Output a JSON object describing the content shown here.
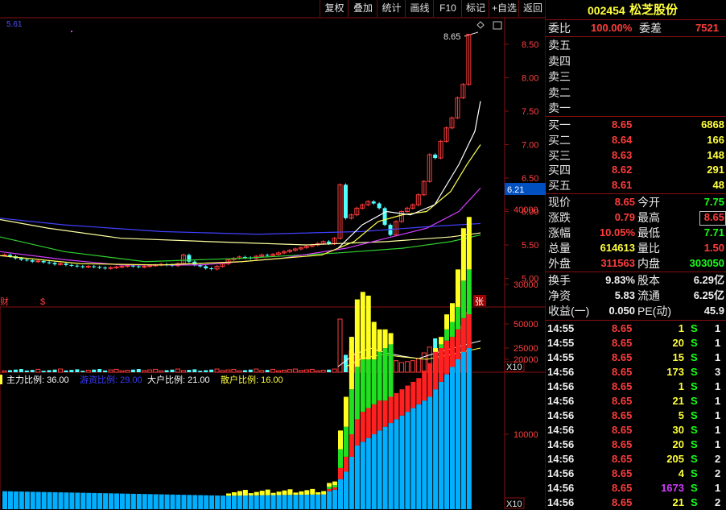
{
  "toolbar": [
    "复权",
    "叠加",
    "统计",
    "画线",
    "F10",
    "标记",
    "+自选",
    "返回"
  ],
  "stock": {
    "code": "002454",
    "name": "松芝股份"
  },
  "chart": {
    "ma_label": "5.61",
    "high_note": "8.65",
    "current_price": "6.21",
    "price_ticks": [
      "8.50",
      "8.00",
      "7.50",
      "7.00",
      "6.50",
      "6.00",
      "5.50",
      "5.00"
    ],
    "markers": {
      "cai": "财",
      "dollar": "$",
      "zhang": "张"
    },
    "vol_ticks": [
      "50000",
      "25000"
    ],
    "vol_multiplier": "X10",
    "bottom_ticks": [
      "40000",
      "30000",
      "20000",
      "10000"
    ],
    "bottom_multiplier": "X10",
    "ratio_legend": [
      {
        "text": "主力比例: 36.00",
        "color": "#ffffff"
      },
      {
        "text": "游资比例: 29.00",
        "color": "#3c3cff"
      },
      {
        "text": "大户比例: 21.00",
        "color": "#ffffff"
      },
      {
        "text": "散户比例: 16.00",
        "color": "#ffff3c"
      }
    ]
  },
  "order_book": {
    "weibi_label": "委比",
    "weibi": "100.00%",
    "weicha_label": "委差",
    "weicha": "7521",
    "sell": [
      {
        "label": "卖五"
      },
      {
        "label": "卖四"
      },
      {
        "label": "卖三"
      },
      {
        "label": "卖二"
      },
      {
        "label": "卖一"
      }
    ],
    "buy": [
      {
        "label": "买一",
        "price": "8.65",
        "vol": "6868"
      },
      {
        "label": "买二",
        "price": "8.64",
        "vol": "166"
      },
      {
        "label": "买三",
        "price": "8.63",
        "vol": "148"
      },
      {
        "label": "买四",
        "price": "8.62",
        "vol": "291"
      },
      {
        "label": "买五",
        "price": "8.61",
        "vol": "48"
      }
    ]
  },
  "quote": {
    "xianjia_l": "现价",
    "xianjia": "8.65",
    "jinkai_l": "今开",
    "jinkai": "7.75",
    "zhangdie_l": "涨跌",
    "zhangdie": "0.79",
    "zuigao_l": "最高",
    "zuigao": "8.65",
    "zhangfu_l": "涨幅",
    "zhangfu": "10.05%",
    "zuidi_l": "最低",
    "zuidi": "7.71",
    "zongliang_l": "总量",
    "zongliang": "614613",
    "liangbi_l": "量比",
    "liangbi": "1.50",
    "waipan_l": "外盘",
    "waipan": "311563",
    "neipan_l": "内盘",
    "neipan": "303050",
    "huanshou_l": "换手",
    "huanshou": "9.83%",
    "guben_l": "股本",
    "guben": "6.29亿",
    "jingzi_l": "净资",
    "jingzi": "5.83",
    "liutong_l": "流通",
    "liutong": "6.25亿",
    "shouyi_l": "收益(一)",
    "shouyi": "0.050",
    "pe_l": "PE(动)",
    "pe": "45.9"
  },
  "ticks": [
    {
      "time": "14:55",
      "price": "8.65",
      "vol": "1",
      "side": "S",
      "n": "1"
    },
    {
      "time": "14:55",
      "price": "8.65",
      "vol": "20",
      "side": "S",
      "n": "1"
    },
    {
      "time": "14:55",
      "price": "8.65",
      "vol": "15",
      "side": "S",
      "n": "1"
    },
    {
      "time": "14:56",
      "price": "8.65",
      "vol": "173",
      "side": "S",
      "n": "3"
    },
    {
      "time": "14:56",
      "price": "8.65",
      "vol": "1",
      "side": "S",
      "n": "1"
    },
    {
      "time": "14:56",
      "price": "8.65",
      "vol": "21",
      "side": "S",
      "n": "1"
    },
    {
      "time": "14:56",
      "price": "8.65",
      "vol": "5",
      "side": "S",
      "n": "1"
    },
    {
      "time": "14:56",
      "price": "8.65",
      "vol": "30",
      "side": "S",
      "n": "1"
    },
    {
      "time": "14:56",
      "price": "8.65",
      "vol": "20",
      "side": "S",
      "n": "1"
    },
    {
      "time": "14:56",
      "price": "8.65",
      "vol": "205",
      "side": "S",
      "n": "2"
    },
    {
      "time": "14:56",
      "price": "8.65",
      "vol": "4",
      "side": "S",
      "n": "2"
    },
    {
      "time": "14:56",
      "price": "8.65",
      "vol": "1673",
      "side": "S",
      "n": "1",
      "purple": true
    },
    {
      "time": "14:56",
      "price": "8.65",
      "vol": "21",
      "side": "S",
      "n": "2"
    }
  ]
}
